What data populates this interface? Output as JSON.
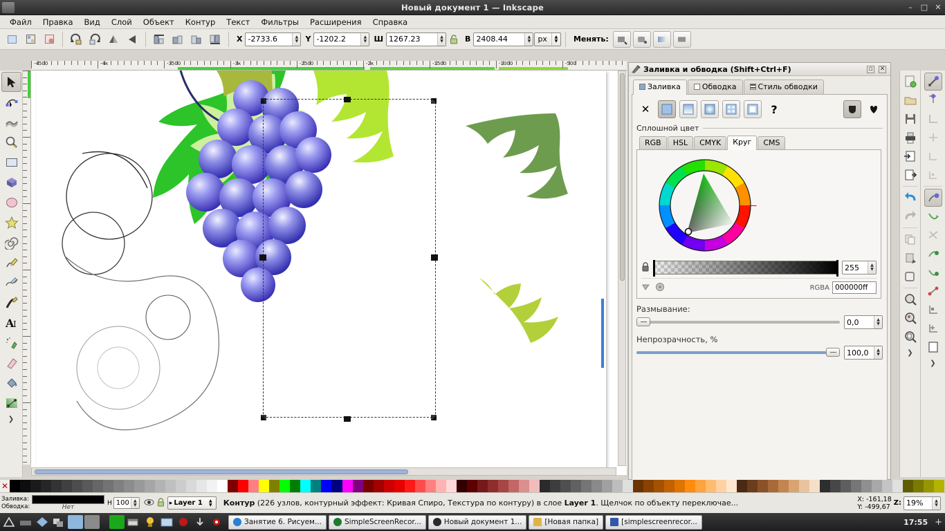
{
  "window": {
    "title": "Новый документ 1 — Inkscape",
    "min": "–",
    "max": "□",
    "close": "✕"
  },
  "menu": [
    "Файл",
    "Правка",
    "Вид",
    "Слой",
    "Объект",
    "Контур",
    "Текст",
    "Фильтры",
    "Расширения",
    "Справка"
  ],
  "toolbar": {
    "x_label": "X",
    "x_value": "-2733.6",
    "y_label": "Y",
    "y_value": "-1202.2",
    "w_label": "Ш",
    "w_value": "1267.23",
    "h_label": "В",
    "h_value": "2408.44",
    "unit": "px",
    "affect_label": "Менять:"
  },
  "ruler": {
    "h_labels": [
      "-4500",
      "-4к",
      "-3500",
      "-3к",
      "-2500",
      "-2к",
      "-1500",
      "-1000",
      "-500"
    ]
  },
  "tools": [
    {
      "name": "selector-tool",
      "label": "Выделитель"
    },
    {
      "name": "node-tool",
      "label": "Редактор узлов"
    },
    {
      "name": "tweak-tool",
      "label": "Коррекция"
    },
    {
      "name": "zoom-tool",
      "label": "Лупа"
    },
    {
      "name": "rectangle-tool",
      "label": "Прямоугольник"
    },
    {
      "name": "box3d-tool",
      "label": "3D-объект"
    },
    {
      "name": "ellipse-tool",
      "label": "Эллипс"
    },
    {
      "name": "star-tool",
      "label": "Звезда"
    },
    {
      "name": "spiral-tool",
      "label": "Спираль"
    },
    {
      "name": "pencil-tool",
      "label": "Карандаш"
    },
    {
      "name": "bezier-tool",
      "label": "Перо"
    },
    {
      "name": "calligraphy-tool",
      "label": "Каллиграфия"
    },
    {
      "name": "text-tool",
      "label": "Текст"
    },
    {
      "name": "spray-tool",
      "label": "Распылитель"
    },
    {
      "name": "eraser-tool",
      "label": "Ластик"
    },
    {
      "name": "paintbucket-tool",
      "label": "Заливка"
    },
    {
      "name": "gradient-tool",
      "label": "Градиент"
    }
  ],
  "dialog": {
    "title": "Заливка и обводка (Shift+Ctrl+F)",
    "tabs": [
      {
        "label": "Заливка",
        "selected": true
      },
      {
        "label": "Обводка",
        "selected": false
      },
      {
        "label": "Стиль обводки",
        "selected": false
      }
    ],
    "fill_types": [
      "none",
      "flat",
      "linear-gradient",
      "radial-gradient",
      "pattern",
      "swatch",
      "unknown"
    ],
    "fill_none_glyph": "✕",
    "fill_unknown_glyph": "?",
    "section_label": "Сплошной цвет",
    "color_tabs": [
      {
        "label": "RGB",
        "selected": false
      },
      {
        "label": "HSL",
        "selected": false
      },
      {
        "label": "CMYK",
        "selected": false
      },
      {
        "label": "Круг",
        "selected": true
      },
      {
        "label": "CMS",
        "selected": false
      }
    ],
    "alpha_value": "255",
    "rgba_label": "RGBA",
    "rgba_value": "000000ff",
    "blur_label": "Размывание:",
    "blur_value": "0,0",
    "opacity_label": "Непрозрачность, %",
    "opacity_value": "100,0",
    "opacity_percent": 100,
    "blur_percent": 0
  },
  "status": {
    "fill_label": "Заливка:",
    "stroke_label": "Обводка:",
    "stroke_value": "Нет",
    "opacity_abbr": "Н",
    "opacity_value": "100",
    "layer_name": "Layer 1",
    "message_bold": "Контур",
    "message_rest": " (226 узлов, контурный эффект: Кривая Спиро, Текстура по контуру) в слое ",
    "message_layer": "Layer 1",
    "message_tail": ". Щелчок по объекту переключае...",
    "pointer_x_label": "X:",
    "pointer_x": "-161,18",
    "pointer_y_label": "Y:",
    "pointer_y": "-499,67",
    "zoom_label": "Z:",
    "zoom_value": "19%"
  },
  "taskbar": {
    "items": [
      {
        "label": "Занятие 6. Рисуем...",
        "color": "#2b7fd4",
        "active": false
      },
      {
        "label": "SimpleScreenRecor...",
        "color": "#1f7a2e",
        "active": false
      },
      {
        "label": "Новый документ 1...",
        "color": "#2a2a2a",
        "active": true
      },
      {
        "label": "[Новая папка]",
        "color": "#e0b34a",
        "active": false
      },
      {
        "label": "[simplescreenrecor...",
        "color": "#3457a8",
        "active": false
      }
    ],
    "clock": "17:55",
    "tray_more": "+"
  },
  "palette_colors": [
    "#000000",
    "#0d0d0d",
    "#1a1a1a",
    "#262626",
    "#333333",
    "#404040",
    "#4d4d4d",
    "#595959",
    "#666666",
    "#737373",
    "#808080",
    "#8c8c8c",
    "#999999",
    "#a6a6a6",
    "#b3b3b3",
    "#bfbfbf",
    "#cccccc",
    "#d9d9d9",
    "#e6e6e6",
    "#f2f2f2",
    "#ffffff",
    "#800000",
    "#ff0000",
    "#ff8080",
    "#ffff00",
    "#808000",
    "#00ff00",
    "#008000",
    "#00ffff",
    "#008080",
    "#0000ff",
    "#000080",
    "#ff00ff",
    "#800080",
    "#7a0000",
    "#a30000",
    "#cc0000",
    "#e60000",
    "#ff1a1a",
    "#ff4d4d",
    "#ff8080",
    "#ffb3b3",
    "#ffd9d9",
    "#330000",
    "#5c0000",
    "#751a1a",
    "#8f2d2d",
    "#a84545",
    "#c26666",
    "#db8f8f",
    "#f0bcbc",
    "#2b2b2b",
    "#3d3d3d",
    "#4f4f4f",
    "#616161",
    "#757575",
    "#8a8a8a",
    "#a0a0a0",
    "#bdbdbd",
    "#dedede",
    "#6b3300",
    "#8a4200",
    "#a35200",
    "#c26200",
    "#e07400",
    "#ff8c0d",
    "#ff A",
    "#ffa33d",
    "#ffbb70",
    "#ffd2a3",
    "#ffe8d1",
    "#4a2a12",
    "#6b3d1c",
    "#8c5227",
    "#a86a38",
    "#c2854f",
    "#d8a473",
    "#e8c39e",
    "#f5dfc8",
    "#2e2e2e",
    "#474747",
    "#5e5e5e",
    "#767676",
    "#8f8f8f",
    "#a8a8a8",
    "#c4c4c4",
    "#e0e0e0",
    "#5e5e00",
    "#7a7a00",
    "#969600",
    "#b3b300"
  ],
  "colorwheel": {
    "selected_color": "#000000",
    "triangle_hue": "#22c81e",
    "marker_note": "marker near bottom-left of triangle"
  },
  "canvas": {
    "artwork_name": "grapes-and-leaves-clipart",
    "selection_nodes": 226,
    "leaf_colors": [
      "#28c425",
      "#9fe87a",
      "#c9ef9a",
      "#a6b83a",
      "#6f9a4e",
      "#b8d243",
      "#3aa832"
    ],
    "grape_color_dark": "#3f3fc0",
    "grape_color_light": "#b9b9f2"
  }
}
